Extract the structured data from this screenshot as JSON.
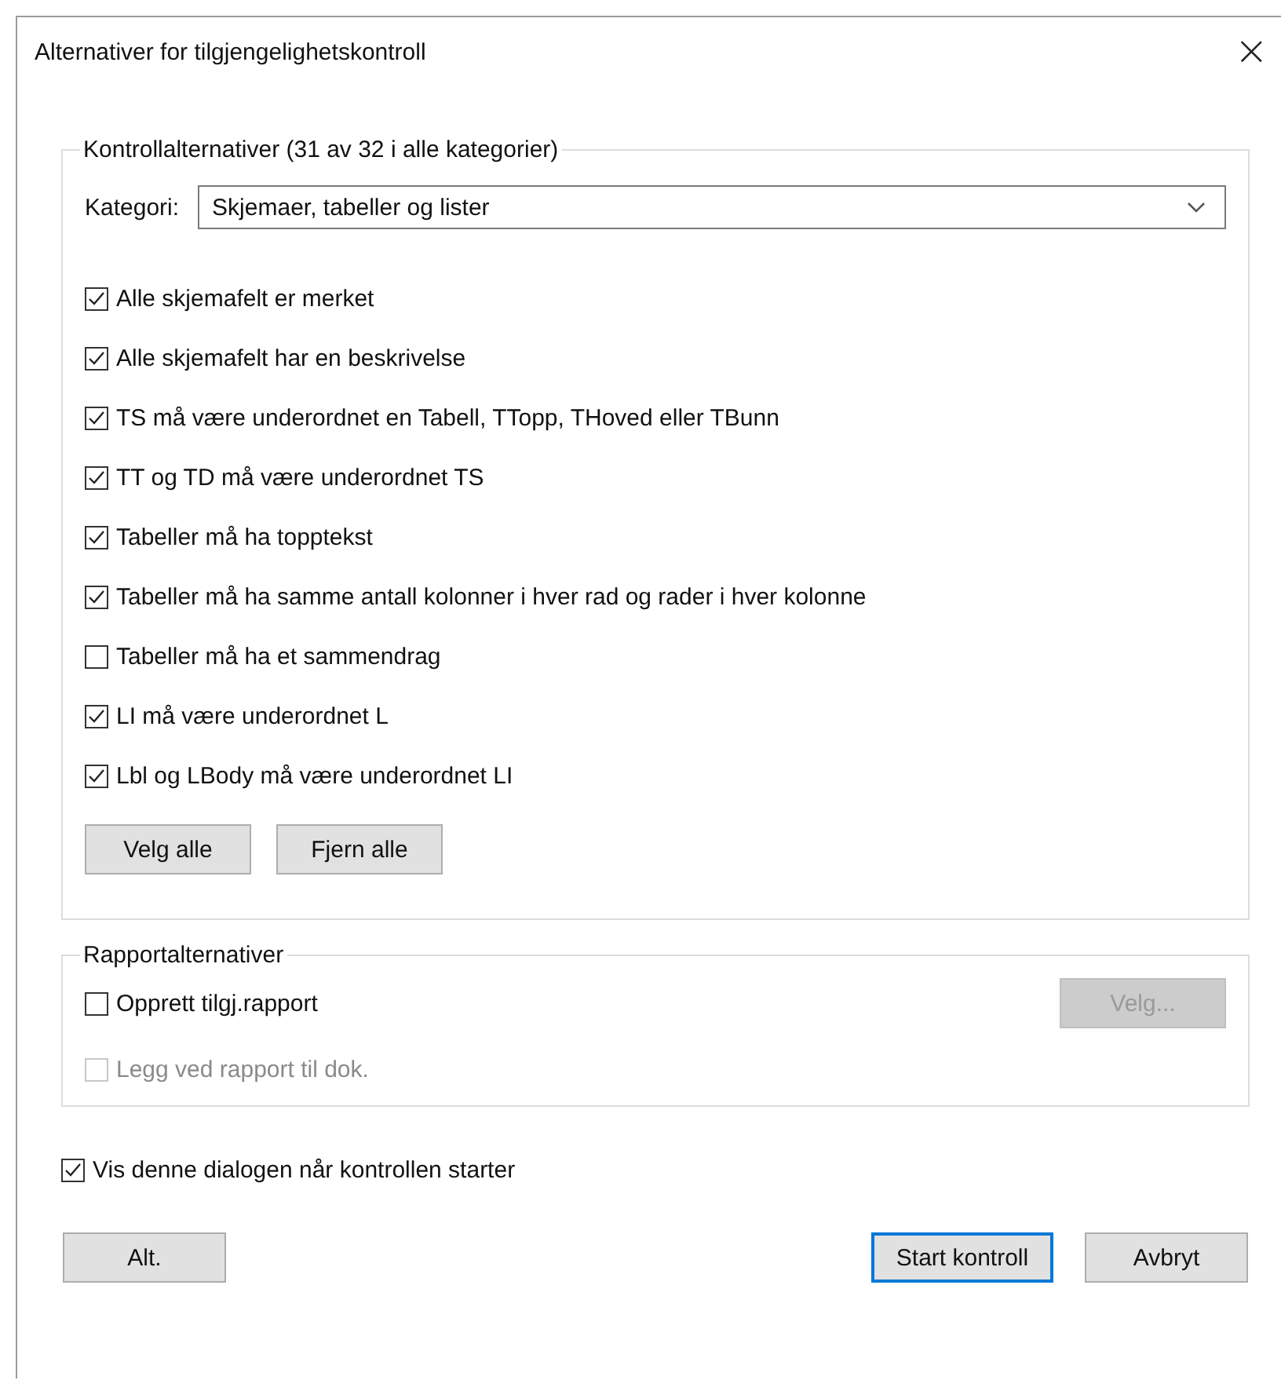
{
  "window": {
    "title": "Alternativer for tilgjengelighetskontroll",
    "close": "×"
  },
  "check_options": {
    "legend": "Kontrollalternativer (31 av 32 i alle kategorier)",
    "category_label": "Kategori:",
    "category_value": "Skjemaer, tabeller og lister",
    "items": [
      {
        "label": "Alle skjemafelt er merket",
        "checked": true
      },
      {
        "label": "Alle skjemafelt har en beskrivelse",
        "checked": true
      },
      {
        "label": "TS må være underordnet en Tabell, TTopp, THoved eller TBunn",
        "checked": true
      },
      {
        "label": "TT og TD må være underordnet TS",
        "checked": true
      },
      {
        "label": "Tabeller må ha topptekst",
        "checked": true
      },
      {
        "label": "Tabeller må ha samme antall kolonner i hver rad og rader i hver kolonne",
        "checked": true
      },
      {
        "label": "Tabeller må ha et sammendrag",
        "checked": false
      },
      {
        "label": "LI må være underordnet L",
        "checked": true
      },
      {
        "label": "Lbl og LBody må være underordnet LI",
        "checked": true
      }
    ],
    "buttons": [
      "Velg alle",
      "Fjern alle"
    ]
  },
  "report_options": {
    "legend": "Rapportalternativer",
    "create_report": {
      "label": "Opprett tilgj.rapport",
      "checked": false,
      "disabled": false
    },
    "choose_button": {
      "label": "Velg...",
      "disabled": true
    },
    "attach_report": {
      "label": "Legg ved rapport til dok.",
      "checked": false,
      "disabled": true
    }
  },
  "show_dialog": {
    "label": "Vis denne dialogen når kontrollen starter",
    "checked": true
  },
  "left_buttons": [
    {
      "label": "Alt.",
      "focused": false
    }
  ],
  "right_buttons": [
    {
      "label": "Start kontroll",
      "focused": true
    },
    {
      "label": "Avbryt",
      "focused": false
    }
  ]
}
